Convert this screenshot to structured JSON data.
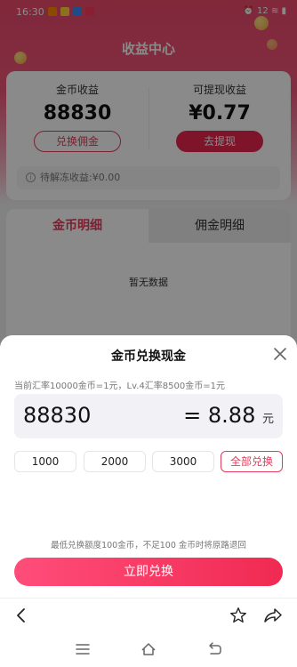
{
  "status_bar": {
    "time": "16:30",
    "right_text": "⏰ 12 ≋ ▮"
  },
  "page": {
    "title": "收益中心"
  },
  "earnings": {
    "coin_label": "金币收益",
    "coin_value": "88830",
    "exchange_button": "兑换佣金",
    "withdrawable_label": "可提现收益",
    "withdrawable_value": "¥0.77",
    "withdraw_button": "去提现",
    "pending_text": "待解冻收益:¥0.00"
  },
  "tabs": {
    "coin_detail": "金币明细",
    "commission_detail": "佣金明细",
    "empty": "暂无数据"
  },
  "sheet": {
    "title": "金币兑换现金",
    "rate_text": "当前汇率10000金币=1元，Lv.4汇率8500金币=1元",
    "amount": "88830",
    "result": "= 8.88",
    "result_unit": "元",
    "quick_options": [
      "1000",
      "2000",
      "3000"
    ],
    "all_button": "全部兑换",
    "tip": "最低兑换额度100金币，不足100 金币时将原路退回",
    "confirm_button": "立即兑换"
  },
  "colors": {
    "accent": "#e8264f",
    "brand_gradient_start": "#ef4a6d"
  },
  "icons": [
    "close-icon",
    "back-arrow-icon",
    "star-icon",
    "share-icon",
    "menu-icon",
    "home-icon",
    "return-icon",
    "info-icon"
  ]
}
